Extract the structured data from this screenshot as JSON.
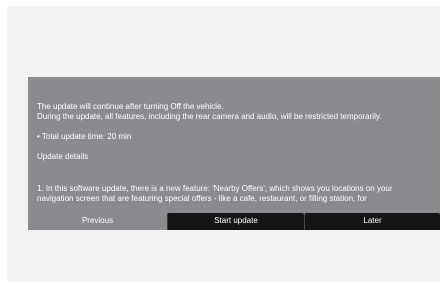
{
  "dialog": {
    "message_line_1": "The update will continue after turning Off the vehicle.",
    "message_line_2": "During the update, all features, including the rear camera and audio, will be restricted temporarily.",
    "total_update_time": "• Total update time: 20 min",
    "details_link": "Update details",
    "note_line_1": "1. In this software update, there is a new feature: 'Nearby Offers', which shows you locations on your",
    "note_line_2": "navigation screen that are featuring special offers - like a cafe, restaurant, or filling station, for"
  },
  "buttons": {
    "previous": "Previous",
    "start_update": "Start update",
    "later": "Later"
  },
  "colors": {
    "dialog_background": "#8b8a8e",
    "button_dark": "#151515",
    "screen_background": "#f4f3f4",
    "text": "#ffffff"
  }
}
